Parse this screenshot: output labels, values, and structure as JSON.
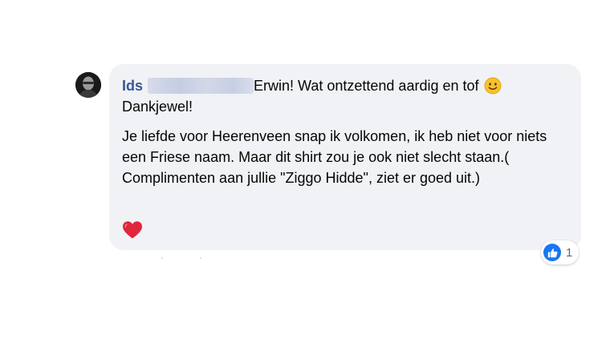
{
  "comment": {
    "author": "Ids",
    "text_line1": "Erwin! Wat ontzettend aardig en tof",
    "text_line1_cont": "Dankjewel!",
    "paragraph2": "Je liefde voor Heerenveen snap ik volkomen, ik heb niet voor niets een Friese naam. Maar dit shirt zou je ook niet slecht staan.( Complimenten aan jullie \"Ziggo Hidde\", ziet er goed uit.)",
    "bubble_color": "#f0f2f5",
    "author_color": "#385898"
  },
  "reactions": {
    "icon": "like-icon",
    "count": "1",
    "color": "#1877f2"
  },
  "emojis": {
    "inline": "smile-emoji-icon",
    "trailing": "heart-emoji-icon"
  }
}
